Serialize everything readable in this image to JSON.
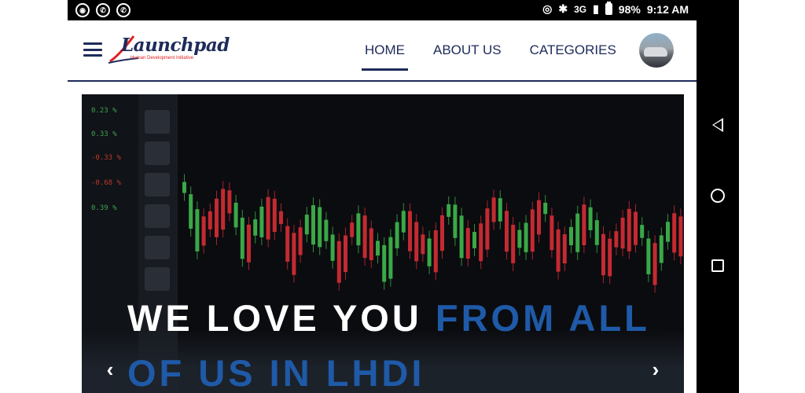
{
  "status_bar": {
    "left_icons": [
      "chrome-icon",
      "whatsapp-icon",
      "whatsapp-icon"
    ],
    "network": "3G",
    "battery": "98%",
    "time": "9:12 AM"
  },
  "header": {
    "logo_title": "Launchpad",
    "logo_subtitle": "Human Development Initiative",
    "menu": [
      {
        "label": "HOME",
        "active": true
      },
      {
        "label": "ABOUT US",
        "active": false
      },
      {
        "label": "CATEGORIES",
        "active": false
      }
    ]
  },
  "hero": {
    "title_white": "WE LOVE YOU ",
    "title_blue": "FROM ALL OF US IN LHDI",
    "prev_symbol": "‹",
    "next_symbol": "›",
    "percent_labels": [
      "0.23 %",
      "0.33 %",
      "-0.33 %",
      "-0.68 %",
      "0.39 %"
    ]
  },
  "colors": {
    "brand_navy": "#1e2b5a",
    "highlight_blue": "#1f5aa8",
    "status_bar": "#000000"
  }
}
